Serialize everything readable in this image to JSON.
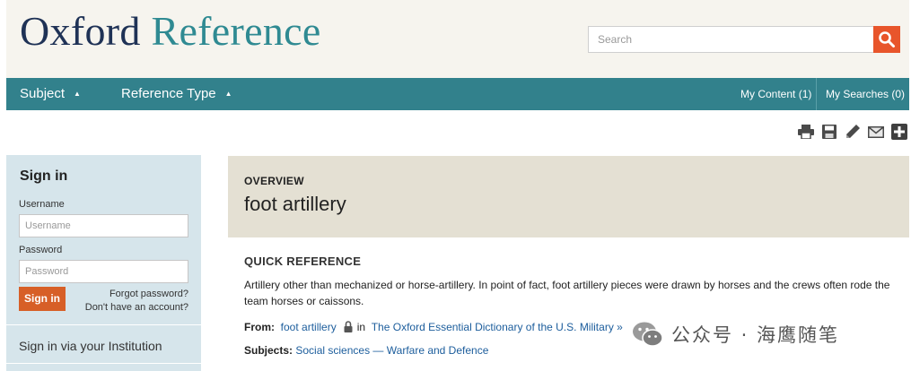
{
  "header": {
    "logo_word1": "Oxford",
    "logo_word2": "Reference",
    "search_placeholder": "Search"
  },
  "nav": {
    "subject": "Subject",
    "reference_type": "Reference Type",
    "my_content": "My Content (1)",
    "my_searches": "My Searches (0)"
  },
  "tools": [
    "print-icon",
    "save-icon",
    "cite-icon",
    "email-icon",
    "share-plus-icon"
  ],
  "signin": {
    "title": "Sign in",
    "username_label": "Username",
    "username_placeholder": "Username",
    "password_label": "Password",
    "password_placeholder": "Password",
    "button": "Sign in",
    "forgot": "Forgot password?",
    "no_account": "Don't have an account?",
    "institution": "Sign in via your Institution"
  },
  "overview": {
    "label": "OVERVIEW",
    "title": "foot artillery"
  },
  "quick_reference": {
    "heading": "QUICK REFERENCE",
    "text": "Artillery other than mechanized or horse-artillery. In point of fact, foot artillery pieces were drawn by horses and the crews often rode the team horses or caissons.",
    "from_label": "From:",
    "from_entry": "foot artillery",
    "in_text": "in",
    "source": "The Oxford Essential Dictionary of the U.S. Military »",
    "subjects_label": "Subjects:",
    "subject_1": "Social sciences",
    "dash": "—",
    "subject_2": "Warfare and Defence"
  },
  "watermark": {
    "text": "公众号 · 海鹰随笔"
  },
  "colors": {
    "nav_teal": "#32818c",
    "accent_orange": "#e8552b",
    "signin_orange": "#d75f27",
    "logo_navy": "#1f3256",
    "logo_teal": "#2f8a92",
    "link_blue": "#1c5d9c",
    "header_bg": "#f6f4ee",
    "overview_bg": "#e4e0d3",
    "sidebar_bg": "#d6e5eb"
  }
}
